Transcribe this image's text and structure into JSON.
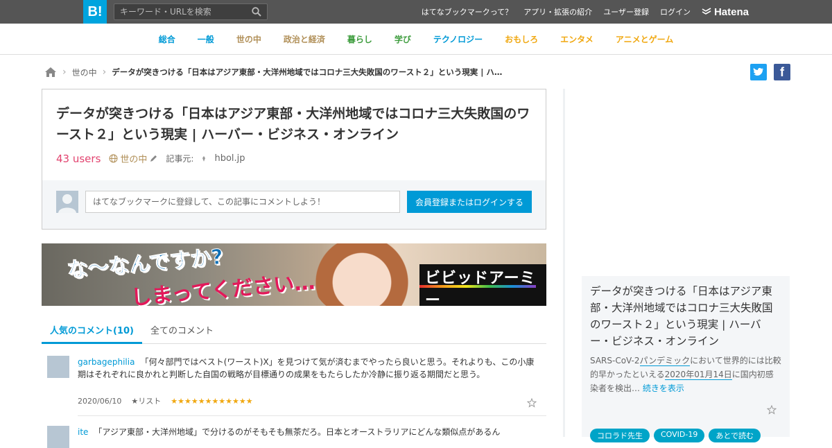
{
  "header": {
    "logo": "B!",
    "search_placeholder": "キーワード・URLを検索",
    "links": [
      "はてなブックマークって？",
      "アプリ・拡張の紹介",
      "ユーザー登録",
      "ログイン"
    ],
    "brand": "Hatena"
  },
  "categories": [
    {
      "label": "総合",
      "color": "#009ad6"
    },
    {
      "label": "一般",
      "color": "#009ad6"
    },
    {
      "label": "世の中",
      "color": "#b19059"
    },
    {
      "label": "政治と経済",
      "color": "#b19059"
    },
    {
      "label": "暮らし",
      "color": "#3f9d3f"
    },
    {
      "label": "学び",
      "color": "#3f9d3f"
    },
    {
      "label": "テクノロジー",
      "color": "#009ad6"
    },
    {
      "label": "おもしろ",
      "color": "#f0a811"
    },
    {
      "label": "エンタメ",
      "color": "#f0a811"
    },
    {
      "label": "アニメとゲーム",
      "color": "#f0a811"
    }
  ],
  "breadcrumb": {
    "category": "世の中",
    "current": "データが突きつける「日本はアジア東部・大洋州地域ではコロナ三大失敗国のワースト２」という現実 | ハ…"
  },
  "share": {
    "twitter": "t",
    "facebook": "f"
  },
  "entry": {
    "title": "データが突きつける「日本はアジア東部・大洋州地域ではコロナ三大失敗国のワースト２」という現実 | ハーバー・ビジネス・オンライン",
    "users": "43 users",
    "category": "世の中",
    "source_label": "記事元:",
    "source": "hbol.jp",
    "comment_placeholder": "はてなブックマークに登録して、この記事にコメントしよう！",
    "login_button": "会員登録またはログインする"
  },
  "banner": {
    "line1": "な〜なんですか?",
    "line2": "しまってください…",
    "logo": "ビビッドアーミー"
  },
  "tabs": [
    "人気のコメント(10)",
    "全てのコメント"
  ],
  "comments": [
    {
      "user": "garbagephilia",
      "text": "「何々部門ではベスト(ワースト)X」を見つけて気が済むまでやったら良いと思う。それよりも、この小康期はそれぞれに良かれと判断した自国の戦略が目標通りの成果をもたらしたか冷静に振り返る期間だと思う。",
      "date": "2020/06/10",
      "list": "★リスト",
      "stars": "★★★★★★★★★★★★"
    },
    {
      "user": "ite",
      "text": "「アジア東部・大洋州地域」で分けるのがそもそも無茶だろ。日本とオーストラリアにどんな類似点があるん"
    }
  ],
  "sidebar": {
    "title": "データが突きつける「日本はアジア東部・大洋州地域ではコロナ三大失敗国のワースト２」という現実 | ハーバー・ビジネス・オンライン",
    "desc_pre": "SARS-CoV-2",
    "desc_kw1": "パンデミック",
    "desc_mid1": "において世界的には比較的早かったといえる",
    "desc_kw2": "2020年01月14日",
    "desc_mid2": "に国内初感染者を検出…",
    "more": "続きを表示",
    "tags": [
      "コロラド先生",
      "COVID-19",
      "あとで読む"
    ]
  }
}
